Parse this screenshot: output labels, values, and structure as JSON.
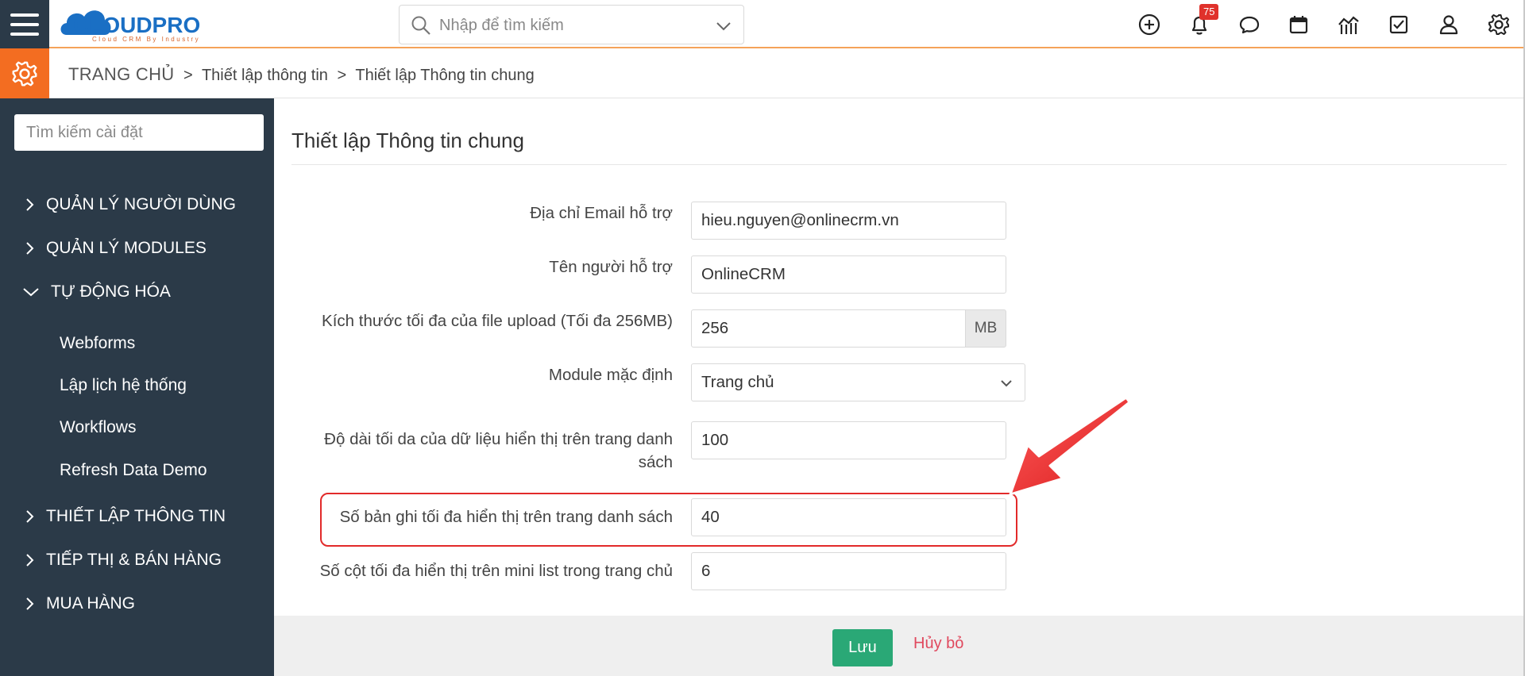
{
  "app": {
    "logo_text": "CLOUDPRO",
    "logo_tagline": "Cloud CRM By Industry"
  },
  "header": {
    "search_placeholder": "Nhập để tìm kiếm",
    "notification_count": "75",
    "icons": [
      "add-circle-icon",
      "bell-icon",
      "chat-icon",
      "calendar-icon",
      "chart-icon",
      "checkbox-icon",
      "user-icon",
      "settings-icon"
    ]
  },
  "breadcrumb": {
    "home": "TRANG CHỦ",
    "level1": "Thiết lập thông tin",
    "level2": "Thiết lập Thông tin chung",
    "separator": ">"
  },
  "sidebar": {
    "search_placeholder": "Tìm kiếm cài đặt",
    "items": [
      {
        "label": "QUẢN LÝ NGƯỜI DÙNG",
        "expanded": false
      },
      {
        "label": "QUẢN LÝ MODULES",
        "expanded": false
      },
      {
        "label": "TỰ ĐỘNG HÓA",
        "expanded": true
      },
      {
        "label": "THIẾT LẬP THÔNG TIN",
        "expanded": false
      },
      {
        "label": "TIẾP THỊ & BÁN HÀNG",
        "expanded": false
      },
      {
        "label": "MUA HÀNG",
        "expanded": false
      }
    ],
    "subitems": [
      "Webforms",
      "Lập lịch hệ thống",
      "Workflows",
      "Refresh Data Demo"
    ]
  },
  "main": {
    "title": "Thiết lập Thông tin chung",
    "fields": [
      {
        "label": "Địa chỉ Email hỗ trợ",
        "value": "hieu.nguyen@onlinecrm.vn"
      },
      {
        "label": "Tên người hỗ trợ",
        "value": "OnlineCRM"
      },
      {
        "label": "Kích thước tối đa của file upload (Tối đa 256MB)",
        "value": "256",
        "addon": "MB"
      },
      {
        "label": "Module mặc định",
        "value": "Trang chủ"
      },
      {
        "label_line1": "Độ dài tối da của dữ liệu hiển thị trên trang danh",
        "label_line2": "sách",
        "value": "100"
      },
      {
        "label": "Số bản ghi tối đa hiển thị trên trang danh sách",
        "value": "40"
      },
      {
        "label": "Số cột tối đa hiển thị trên mini list trong trang chủ",
        "value": "6"
      }
    ]
  },
  "footer": {
    "save_label": "Lưu",
    "cancel_label": "Hủy bỏ"
  },
  "colors": {
    "sidebar_bg": "#2b3a48",
    "accent_orange": "#f36d21",
    "save_green": "#2aa876",
    "cancel_red": "#e0495e",
    "highlight_red": "#e22a2a"
  }
}
